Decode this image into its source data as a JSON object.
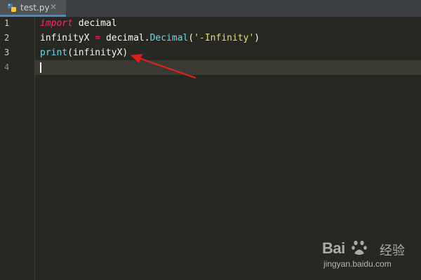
{
  "tab": {
    "filename": "test.py",
    "close_glyph": "✕",
    "icon": "python-file-icon"
  },
  "editor": {
    "line_numbers": [
      "1",
      "2",
      "3",
      "4"
    ],
    "current_line": "4",
    "lines": {
      "l1": {
        "kw": "import",
        "rest": " decimal"
      },
      "l2": {
        "var": "infinityX",
        "op": " = ",
        "mod": "decimal.",
        "cls": "Decimal",
        "open": "(",
        "str": "'-Infinity'",
        "close": ")"
      },
      "l3": {
        "fn": "print",
        "args": "(infinityX)"
      }
    }
  },
  "annotation": {
    "arrow_color": "#e02020"
  },
  "watermark": {
    "brand_latin": "Bai",
    "brand_cn": "经验",
    "url": "jingyan.baidu.com"
  },
  "colors": {
    "background": "#272822",
    "keyword": "#f92672",
    "string": "#e6db74",
    "builtin": "#66d9ef"
  }
}
